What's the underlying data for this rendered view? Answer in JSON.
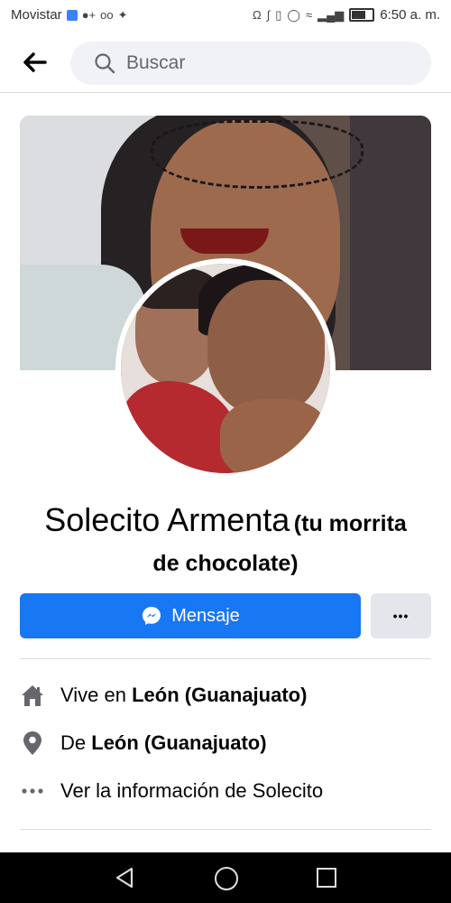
{
  "status_bar": {
    "carrier": "Movistar",
    "time": "6:50 a. m.",
    "left_icons": [
      "shield-icon",
      "person-add-icon",
      "voicemail-icon",
      "twitter-icon"
    ],
    "right_icons": [
      "headset-icon",
      "bluetooth-icon",
      "vibrate-icon",
      "alarm-icon",
      "wifi-icon",
      "signal-icon",
      "battery-icon"
    ]
  },
  "header": {
    "search_placeholder": "Buscar"
  },
  "profile": {
    "name": "Solecito Armenta",
    "nickname_line1": "(tu morrita",
    "nickname_line2": "de chocolate)"
  },
  "actions": {
    "message_label": "Mensaje",
    "more_label": "•••"
  },
  "info": {
    "lives_prefix": "Vive en ",
    "lives_place": "León (Guanajuato)",
    "from_prefix": "De ",
    "from_place": "León (Guanajuato)",
    "more_info": "Ver la información de Solecito"
  },
  "colors": {
    "accent": "#1877f2",
    "secondary_button": "#e4e6eb",
    "search_bg": "#f0f2f5"
  }
}
